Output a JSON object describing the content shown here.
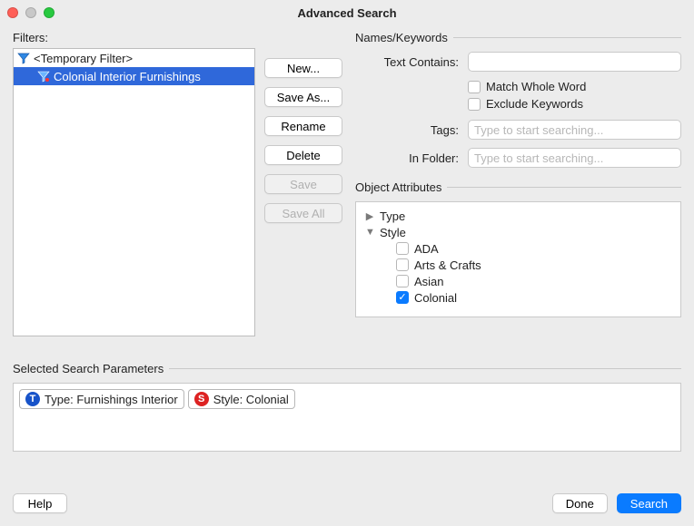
{
  "window": {
    "title": "Advanced Search"
  },
  "filters": {
    "label": "Filters:",
    "items": [
      {
        "label": "<Temporary Filter>"
      },
      {
        "label": "Colonial Interior Furnishings",
        "selected": true
      }
    ]
  },
  "filterButtons": {
    "new": "New...",
    "saveAs": "Save As...",
    "rename": "Rename",
    "delete": "Delete",
    "save": "Save",
    "saveAll": "Save All"
  },
  "names": {
    "section": "Names/Keywords",
    "textContains": "Text Contains:",
    "matchWhole": "Match Whole Word",
    "excludeKw": "Exclude Keywords",
    "tags": "Tags:",
    "tagsPh": "Type to start searching...",
    "inFolder": "In Folder:",
    "folderPh": "Type to start searching..."
  },
  "attrs": {
    "section": "Object Attributes",
    "type": "Type",
    "style": "Style",
    "options": {
      "ada": "ADA",
      "arts": "Arts & Crafts",
      "asian": "Asian",
      "colonial": "Colonial"
    }
  },
  "selParams": {
    "section": "Selected Search Parameters",
    "p1": "Type: Furnishings Interior",
    "p2": "Style: Colonial"
  },
  "footer": {
    "help": "Help",
    "done": "Done",
    "search": "Search"
  }
}
